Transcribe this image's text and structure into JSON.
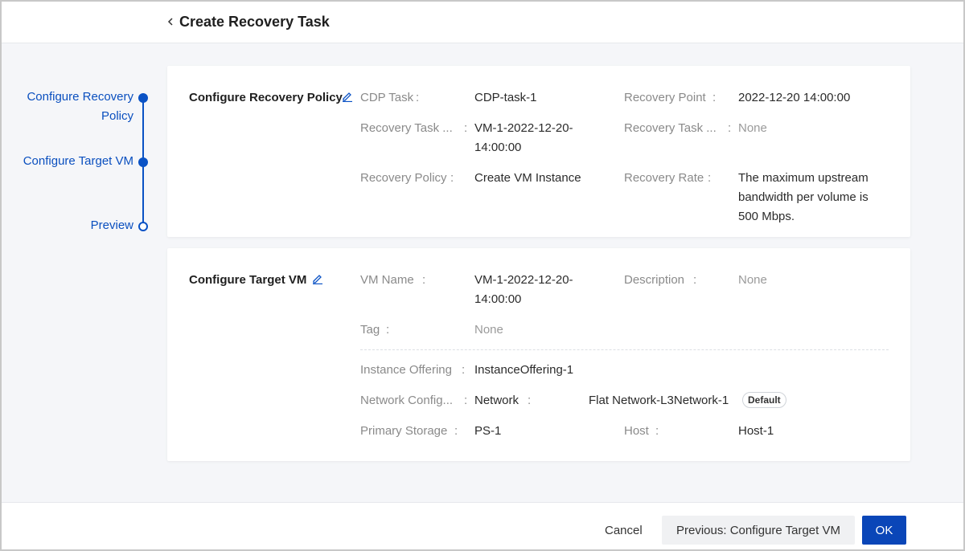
{
  "header": {
    "title": "Create Recovery Task"
  },
  "steps": [
    {
      "label_line1": "Configure Recovery",
      "label_line2": "Policy"
    },
    {
      "label": "Configure Target VM"
    },
    {
      "label": "Preview"
    }
  ],
  "recovery_policy": {
    "title": "Configure Recovery Policy",
    "cdp_task_label": "CDP Task",
    "cdp_task_value": "CDP-task-1",
    "recovery_point_label": "Recovery Point",
    "recovery_point_value": "2022-12-20 14:00:00",
    "recovery_task_name_label": "Recovery Task ...",
    "recovery_task_name_value_line1": "VM-1-2022-12-20-",
    "recovery_task_name_value_line2": "14:00:00",
    "recovery_task_desc_label": "Recovery Task ...",
    "recovery_task_desc_value": "None",
    "recovery_policy_label": "Recovery Policy",
    "recovery_policy_value": "Create VM Instance",
    "recovery_rate_label": "Recovery Rate",
    "recovery_rate_line1": "The maximum upstream",
    "recovery_rate_line2": "bandwidth per volume is",
    "recovery_rate_line3": "500 Mbps."
  },
  "target_vm": {
    "title": "Configure Target VM",
    "vm_name_label": "VM Name",
    "vm_name_value_line1": "VM-1-2022-12-20-",
    "vm_name_value_line2": "14:00:00",
    "description_label": "Description",
    "description_value": "None",
    "tag_label": "Tag",
    "tag_value": "None",
    "instance_offering_label": "Instance Offering",
    "instance_offering_value": "InstanceOffering-1",
    "network_config_label": "Network Config...",
    "network_label": "Network",
    "network_value": "Flat Network-L3Network-1",
    "network_badge": "Default",
    "primary_storage_label": "Primary Storage",
    "primary_storage_value": "PS-1",
    "host_label": "Host",
    "host_value": "Host-1"
  },
  "footer": {
    "cancel_label": "Cancel",
    "previous_label": "Previous: Configure Target VM",
    "ok_label": "OK"
  },
  "colors": {
    "accent": "#0a52c5",
    "primary_button": "#0a46b8"
  },
  "icons": [
    "chevron-left-icon",
    "edit-icon"
  ]
}
